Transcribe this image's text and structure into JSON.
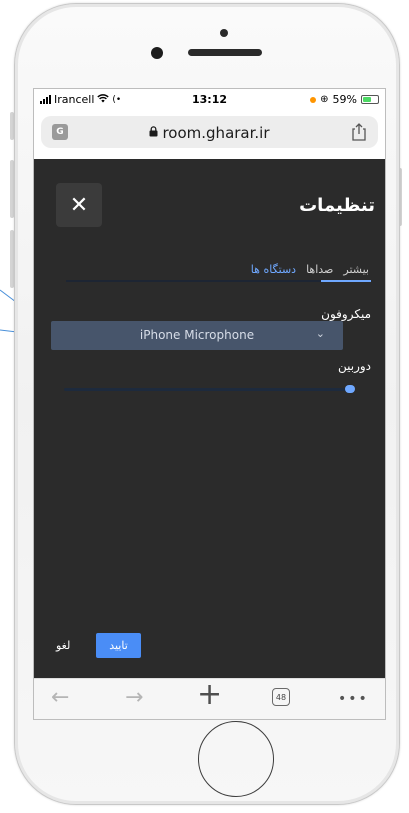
{
  "statusbar": {
    "carrier": "Irancell",
    "time": "13:12",
    "battery": "59%",
    "battery_level": 0.59
  },
  "browser": {
    "url": "room.gharar.ir",
    "tab_count": "48",
    "icons": [
      "translate-icon",
      "lock-icon",
      "share-icon",
      "back-icon",
      "forward-icon",
      "new-tab-icon",
      "tabs-icon",
      "more-icon"
    ]
  },
  "dialog": {
    "title": "تنظیمات",
    "close_symbol": "✕",
    "tabs": [
      {
        "label": "دستگاه ها",
        "active": true
      },
      {
        "label": "صداها",
        "active": false
      },
      {
        "label": "بیشتر",
        "active": false
      }
    ],
    "microphone_label": "میکروفون",
    "microphone_value": "iPhone Microphone",
    "camera_label": "دوربین",
    "confirm_label": "تایید",
    "cancel_label": "لغو"
  },
  "colors": {
    "dialog_bg": "#2b2b2b",
    "accent": "#4a8df6",
    "select_bg": "#47556b"
  }
}
